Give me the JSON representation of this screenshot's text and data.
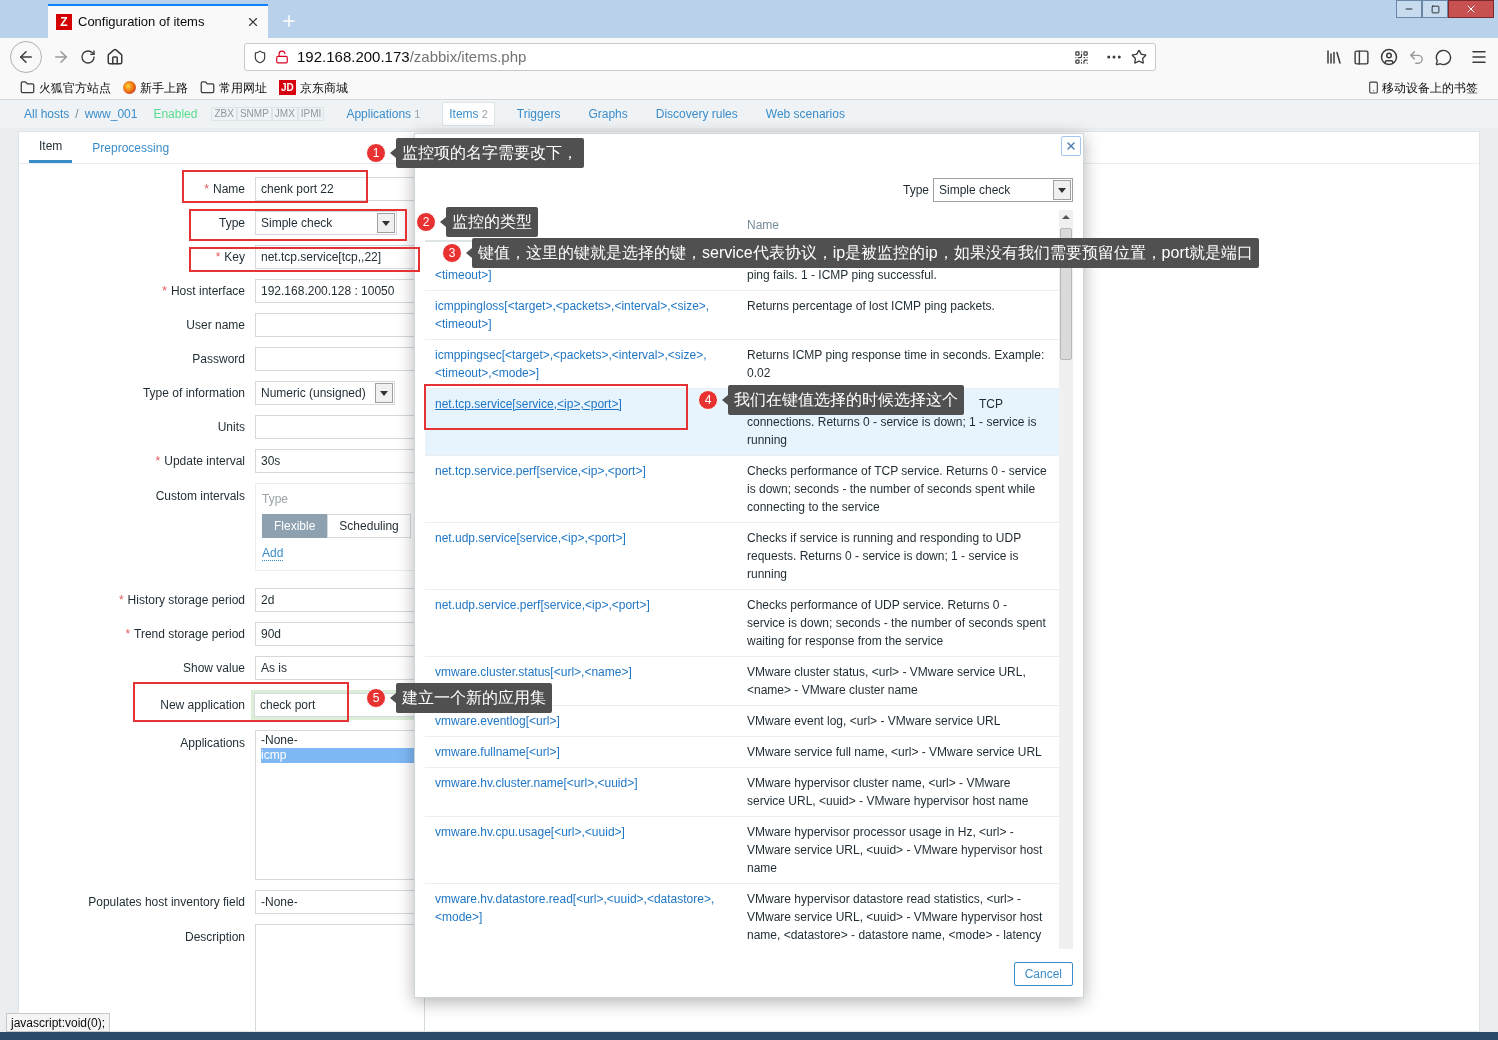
{
  "browser": {
    "tab_icon_text": "Z",
    "tab_title": "Configuration of items",
    "url_host": "192.168.200.173",
    "url_path": "/zabbix/items.php",
    "bookmarks": [
      {
        "kind": "folder",
        "label": "火狐官方站点"
      },
      {
        "kind": "globe",
        "label": "新手上路"
      },
      {
        "kind": "folder",
        "label": "常用网址"
      },
      {
        "kind": "brand",
        "icon_text": "JD",
        "label": "京东商城"
      }
    ],
    "mobile_bookmarks": "移动设备上的书签",
    "status_text": "javascript:void(0);"
  },
  "host_nav": {
    "breadcrumb": [
      "All hosts",
      "www_001"
    ],
    "breadcrumb_separator": "/",
    "status": "Enabled",
    "interfaces": [
      "ZBX",
      "SNMP",
      "JMX",
      "IPMI"
    ],
    "links": [
      {
        "label": "Applications",
        "count": "1",
        "selected": false
      },
      {
        "label": "Items",
        "count": "2",
        "selected": true
      },
      {
        "label": "Triggers",
        "selected": false
      },
      {
        "label": "Graphs",
        "selected": false
      },
      {
        "label": "Discovery rules",
        "selected": false
      },
      {
        "label": "Web scenarios",
        "selected": false
      }
    ]
  },
  "form_tabs": [
    {
      "label": "Item",
      "selected": true
    },
    {
      "label": "Preprocessing",
      "selected": false
    }
  ],
  "fields": [
    {
      "kind": "text",
      "label": "Name",
      "required": true,
      "required_mark": "*",
      "value": "chenk port 22"
    },
    {
      "kind": "select",
      "label": "Type",
      "required": false,
      "value": "Simple check"
    },
    {
      "kind": "text",
      "label": "Key",
      "required": true,
      "required_mark": "*",
      "value": "net.tcp.service[tcp,,22]"
    },
    {
      "kind": "text",
      "label": "Host interface",
      "required": true,
      "required_mark": "*",
      "value": "192.168.200.128 : 10050"
    },
    {
      "kind": "text",
      "label": "User name",
      "required": false
    },
    {
      "kind": "text",
      "label": "Password",
      "required": false
    },
    {
      "kind": "select",
      "label": "Type of information",
      "required": false,
      "value": "Numeric (unsigned)"
    },
    {
      "kind": "text",
      "label": "Units",
      "required": false
    },
    {
      "kind": "text",
      "label": "Update interval",
      "required": true,
      "required_mark": "*",
      "value": "30s"
    },
    {
      "kind": "intervals",
      "label": "Custom intervals",
      "required": false,
      "column": "Type",
      "modes": [
        {
          "label": "Flexible",
          "selected": true
        },
        {
          "label": "Scheduling",
          "selected": false
        }
      ],
      "add": "Add"
    },
    {
      "kind": "text",
      "label": "History storage period",
      "required": true,
      "required_mark": "*",
      "value": "2d"
    },
    {
      "kind": "text",
      "label": "Trend storage period",
      "required": true,
      "required_mark": "*",
      "value": "90d"
    },
    {
      "kind": "text",
      "label": "Show value",
      "required": false,
      "value": "As is"
    },
    {
      "kind": "new",
      "label": "New application",
      "required": false,
      "value": "check port"
    },
    {
      "kind": "list",
      "label": "Applications",
      "required": false,
      "options": [
        {
          "label": "-None-",
          "selected": false
        },
        {
          "label": "icmp",
          "selected": true
        }
      ]
    },
    {
      "kind": "text",
      "label": "Populates host inventory field",
      "required": false,
      "value": "-None-"
    },
    {
      "kind": "textarea",
      "label": "Description",
      "required": false
    }
  ],
  "dialog": {
    "type_label": "Type",
    "type_value": "Simple check",
    "name_header": "Name",
    "cancel": "Cancel",
    "rows": [
      {
        "key": "<timeout>]",
        "key_covered_top": true,
        "description": "ping fails. 1 - ICMP ping successful.",
        "description_covered_top": true,
        "selected": false
      },
      {
        "key": "icmppingloss[<target>,<packets>,<interval>,<size>,<timeout>]",
        "description": "Returns percentage of lost ICMP ping packets.",
        "selected": false
      },
      {
        "key": "icmppingsec[<target>,<packets>,<interval>,<size>,<timeout>,<mode>]",
        "description": "Returns ICMP ping response time in seconds. Example: 0.02",
        "selected": false
      },
      {
        "key": "net.tcp.service[service,<ip>,<port>]",
        "description": "connections. Returns 0 - service is down; 1 - service is running",
        "description_covered_top": true,
        "description_top_tail": "TCP",
        "selected": true
      },
      {
        "key": "net.tcp.service.perf[service,<ip>,<port>]",
        "description": "Checks performance of TCP service. Returns 0 - service is down; seconds - the number of seconds spent while connecting to the service",
        "selected": false
      },
      {
        "key": "net.udp.service[service,<ip>,<port>]",
        "description": "Checks if service is running and responding to UDP requests. Returns 0 - service is down; 1 - service is running",
        "selected": false
      },
      {
        "key": "net.udp.service.perf[service,<ip>,<port>]",
        "description": "Checks performance of UDP service. Returns 0 - service is down; seconds - the number of seconds spent waiting for response from the service",
        "selected": false
      },
      {
        "key": "vmware.cluster.status[<url>,<name>]",
        "description": "VMware cluster status, <url> - VMware service URL, <name> - VMware cluster name",
        "selected": false
      },
      {
        "key": "vmware.eventlog[<url>]",
        "description": "VMware event log, <url> - VMware service URL",
        "selected": false
      },
      {
        "key": "vmware.fullname[<url>]",
        "description": "VMware service full name, <url> - VMware service URL",
        "selected": false
      },
      {
        "key": "vmware.hv.cluster.name[<url>,<uuid>]",
        "description": "VMware hypervisor cluster name, <url> - VMware service URL, <uuid> - VMware hypervisor host name",
        "selected": false
      },
      {
        "key": "vmware.hv.cpu.usage[<url>,<uuid>]",
        "description": "VMware hypervisor processor usage in Hz, <url> - VMware service URL, <uuid> - VMware hypervisor host name",
        "selected": false
      },
      {
        "key": "vmware.hv.datastore.read[<url>,<uuid>,<datastore>,<mode>]",
        "description": "VMware hypervisor datastore read statistics, <url> - VMware service URL, <uuid> - VMware hypervisor host name, <datastore> - datastore name, <mode> - latency",
        "selected": false
      }
    ]
  },
  "annotations": [
    {
      "number": "1",
      "text": "监控项的名字需要改下，"
    },
    {
      "number": "2",
      "text": "监控的类型"
    },
    {
      "number": "3",
      "text": "键值，这里的键就是选择的键，service代表协议，ip是被监控的ip，如果没有我们需要预留位置，port就是端口"
    },
    {
      "number": "4",
      "text": "我们在键值选择的时候选择这个"
    },
    {
      "number": "5",
      "text": "建立一个新的应用集"
    }
  ]
}
